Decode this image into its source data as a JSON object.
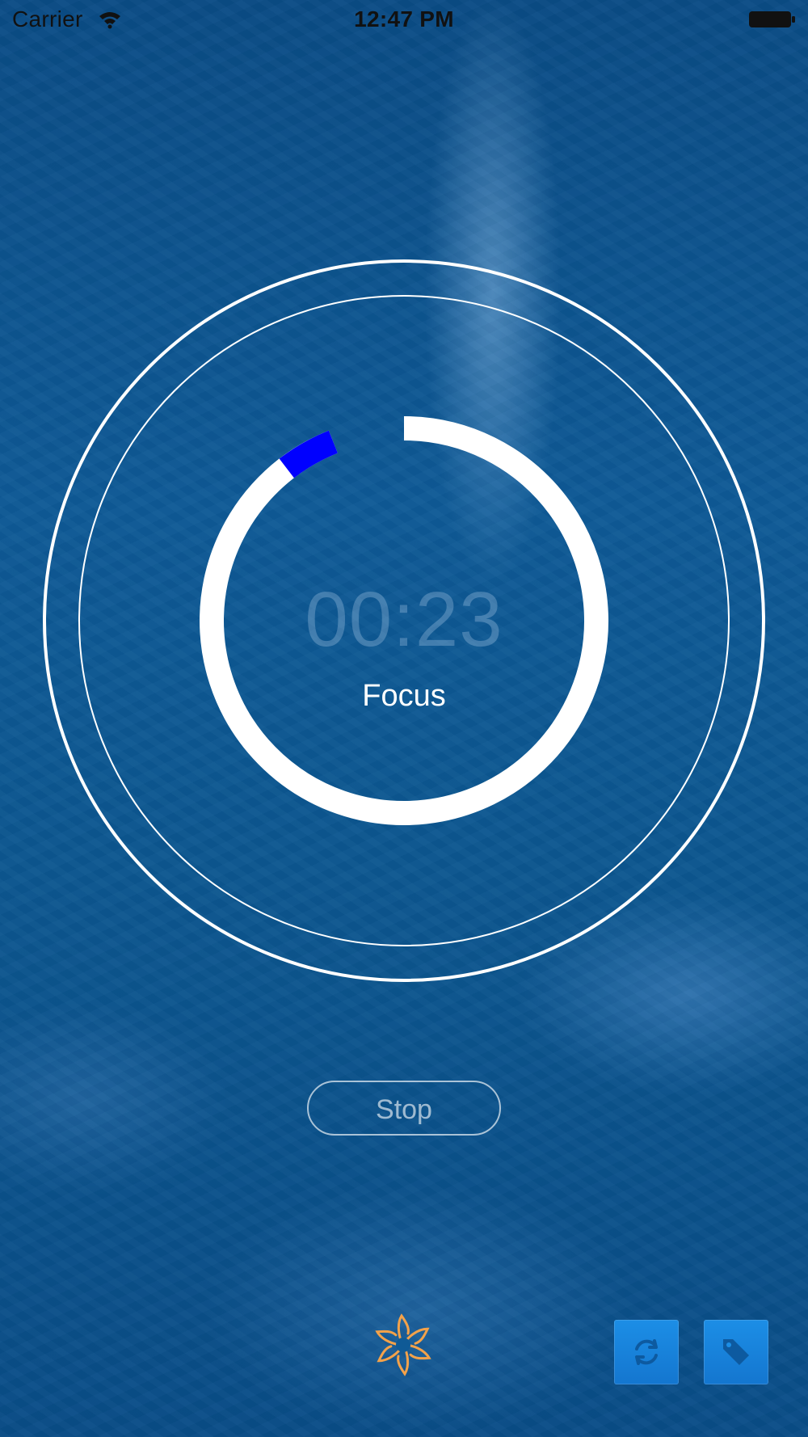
{
  "status_bar": {
    "carrier": "Carrier",
    "time": "12:47 PM"
  },
  "timer": {
    "time": "00:23",
    "mode": "Focus",
    "progress_fraction": 0.94,
    "marker_color": "#0000ff",
    "ring_color": "#ffffff"
  },
  "controls": {
    "stop_label": "Stop"
  },
  "icons": {
    "wifi": "wifi-icon",
    "battery": "battery-icon",
    "logo": "flower-logo-icon",
    "reset": "refresh-icon",
    "tag": "tag-icon"
  },
  "colors": {
    "background": "#0d4d86",
    "corner_button": "#1c8ee6",
    "logo_orange": "#f3a24a"
  }
}
